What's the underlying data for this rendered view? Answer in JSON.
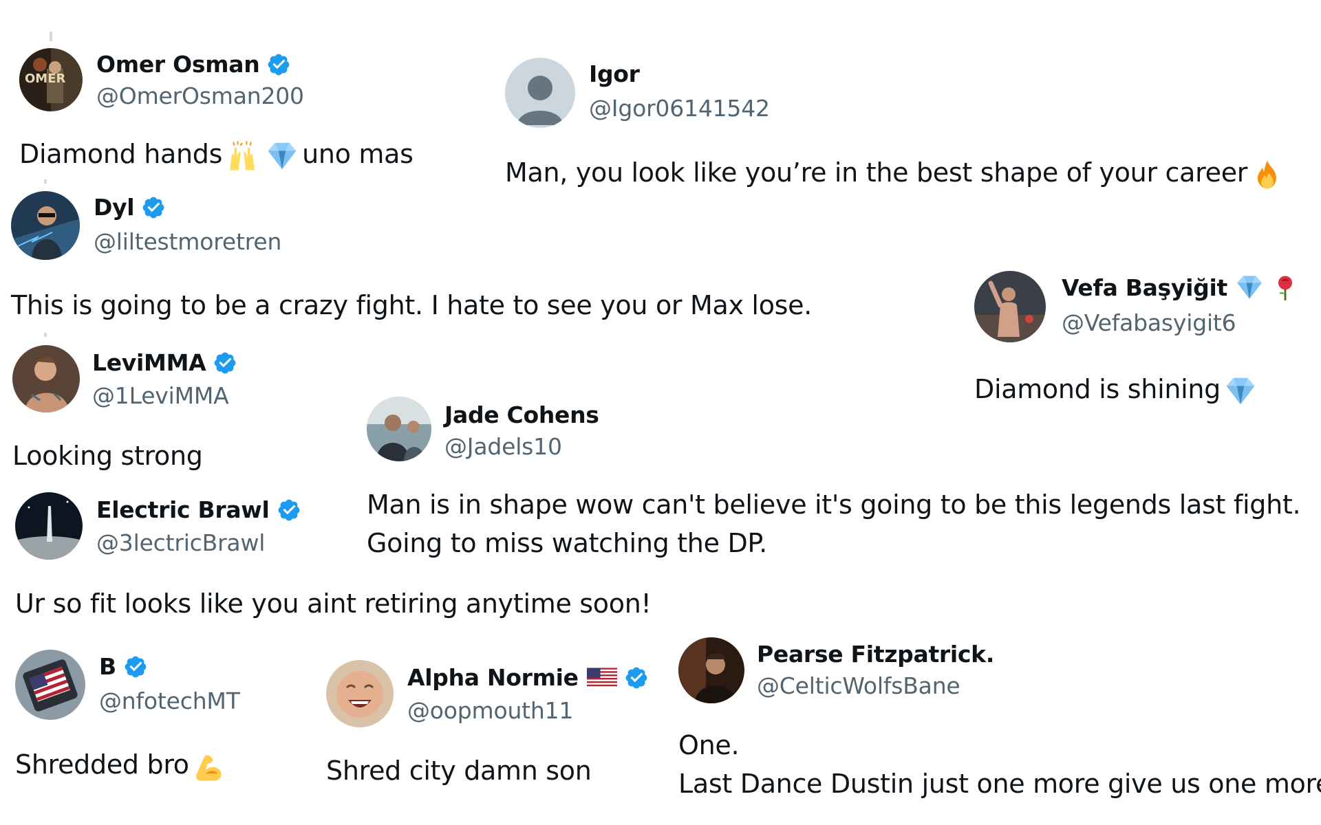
{
  "colors": {
    "verified": "#1d9bf0",
    "text": "#0f1419",
    "handle": "#536471",
    "background": "#ffffff"
  },
  "tweets": [
    {
      "name": "Omer Osman",
      "handle": "@OmerOsman200",
      "text_before": "Diamond hands",
      "emojis": [
        "raising-hands-emoji",
        "gem-emoji"
      ],
      "text_after": "uno mas",
      "verified": true
    },
    {
      "name": "Igor",
      "handle": "@Igor06141542",
      "text": "Man, you look like you’re in the best shape of your career",
      "emojis": [
        "fire-emoji"
      ],
      "verified": false
    },
    {
      "name": "Dyl",
      "handle": "@liltestmoretren",
      "text": "This is going to be a crazy fight. I hate to see you or Max lose.",
      "verified": true
    },
    {
      "name": "Vefa Başyiğit",
      "handle": "@Vefabasyigit6",
      "name_emojis": [
        "gem-emoji",
        "rose-emoji"
      ],
      "text": "Diamond is shining",
      "emojis": [
        "gem-emoji"
      ],
      "verified": false
    },
    {
      "name": "LeviMMA",
      "handle": "@1LeviMMA",
      "text": "Looking strong",
      "verified": true
    },
    {
      "name": "Jade Cohens",
      "handle": "@Jadels10",
      "text_line1": "Man is in shape wow can't believe it's going to be this legends last fight.",
      "text_line2": "Going to miss watching the DP.",
      "verified": false
    },
    {
      "name": "Electric Brawl",
      "handle": "@3lectricBrawl",
      "text": "Ur so fit looks like you aint retiring anytime soon!",
      "verified": true
    },
    {
      "name": "B",
      "handle": "@nfotechMT",
      "text": "Shredded bro",
      "emojis": [
        "flexed-biceps-emoji"
      ],
      "verified": true
    },
    {
      "name": "Alpha Normie",
      "handle": "@oopmouth11",
      "name_emojis": [
        "us-flag-emoji"
      ],
      "text": "Shred city damn son",
      "verified": true
    },
    {
      "name": "Pearse Fitzpatrick.",
      "handle": "@CelticWolfsBane",
      "text_line1": "One.",
      "text_line2": "Last Dance Dustin just one more give us one more",
      "verified": false
    }
  ]
}
